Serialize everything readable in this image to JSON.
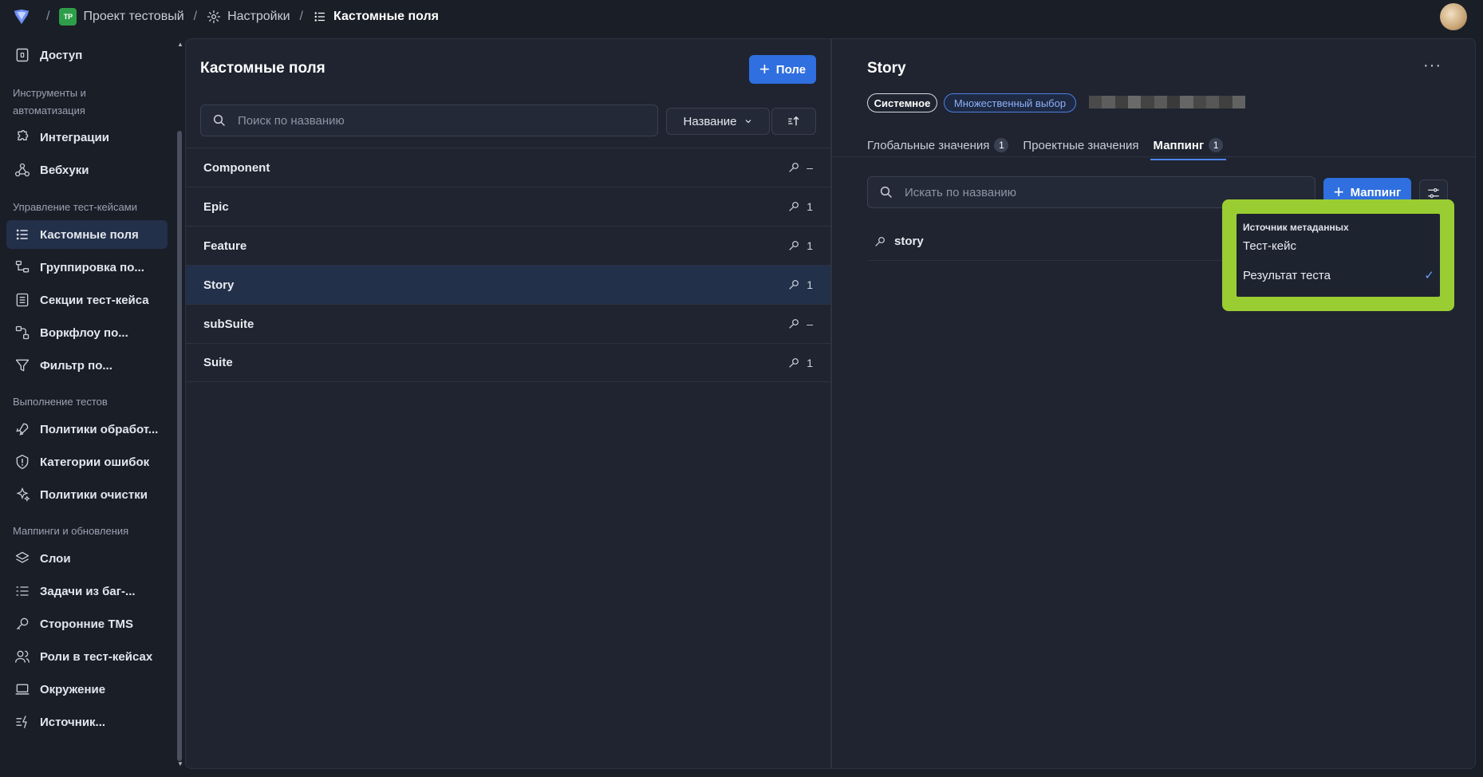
{
  "breadcrumbs": {
    "project_badge": "TP",
    "project": "Проект тестовый",
    "settings": "Настройки",
    "current": "Кастомные поля"
  },
  "sidebar": {
    "top_item": "Доступ",
    "sections": [
      {
        "title": "Инструменты и автоматизация",
        "items": [
          "Интеграции",
          "Вебхуки"
        ]
      },
      {
        "title": "Управление тест-кейсами",
        "items": [
          "Кастомные поля",
          "Группировка по...",
          "Секции тест-кейса",
          "Воркфлоу по...",
          "Фильтр по..."
        ]
      },
      {
        "title": "Выполнение тестов",
        "items": [
          "Политики обработ...",
          "Категории ошибок",
          "Политики очистки"
        ]
      },
      {
        "title": "Маппинги и обновления",
        "items": [
          "Слои",
          "Задачи из баг-...",
          "Сторонние TMS",
          "Роли в тест-кейсах",
          "Окружение",
          "Источник..."
        ]
      }
    ],
    "active_item": "Кастомные поля"
  },
  "left_panel": {
    "title": "Кастомные поля",
    "add_button": "Поле",
    "search_placeholder": "Поиск по названию",
    "sort_label": "Название",
    "fields": [
      {
        "name": "Component",
        "count": "–"
      },
      {
        "name": "Epic",
        "count": "1"
      },
      {
        "name": "Feature",
        "count": "1"
      },
      {
        "name": "Story",
        "count": "1"
      },
      {
        "name": "subSuite",
        "count": "–"
      },
      {
        "name": "Suite",
        "count": "1"
      }
    ],
    "selected": "Story"
  },
  "right_panel": {
    "title": "Story",
    "tag_system": "Системное",
    "tag_multi": "Множественный выбор",
    "tabs": [
      {
        "label": "Глобальные значения",
        "count": "1"
      },
      {
        "label": "Проектные значения",
        "count": ""
      },
      {
        "label": "Маппинг",
        "count": "1"
      }
    ],
    "active_tab": "Маппинг",
    "search_placeholder": "Искать по названию",
    "add_button": "Маппинг",
    "mapping_items": [
      "story"
    ]
  },
  "dropdown": {
    "header": "Источник метаданных",
    "options": [
      {
        "label": "Тест-кейс",
        "checked": false
      },
      {
        "label": "Результат теста",
        "checked": true
      }
    ]
  },
  "colors": {
    "accent": "#2f6fe0",
    "highlight": "#9acd32",
    "background": "#1a1e27"
  }
}
